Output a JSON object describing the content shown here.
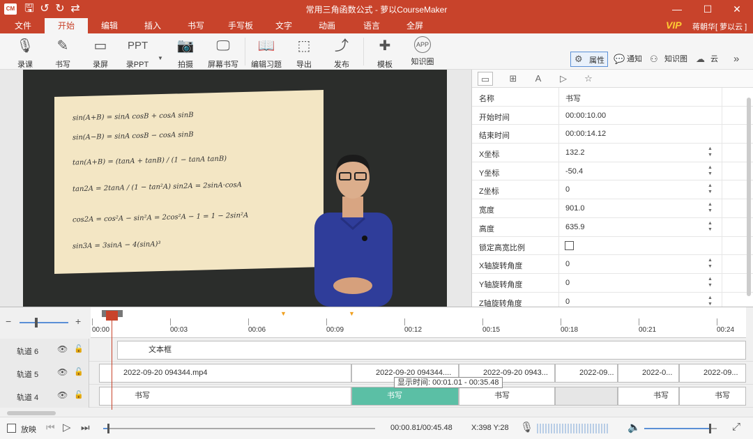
{
  "window": {
    "title": "常用三角函数公式 - 萝以CourseMaker",
    "logo_text": "CM",
    "min_icon": "—",
    "max_icon": "☐",
    "close_icon": "✕"
  },
  "menu": {
    "items": [
      "文件",
      "开始",
      "编辑",
      "插入",
      "书写",
      "手写板",
      "文字",
      "动画",
      "语言",
      "全屏"
    ],
    "active_index": 1,
    "vip": "VIP",
    "user": "蒋朝华[ 萝以云 ]"
  },
  "ribbon": {
    "buttons": [
      {
        "label": "录课",
        "icon": "🎙"
      },
      {
        "label": "书写",
        "icon": "✎"
      },
      {
        "label": "录屏",
        "icon": "▭"
      },
      {
        "label": "录PPT",
        "icon": "PPT"
      },
      {
        "label": "拍摄",
        "icon": "📷"
      },
      {
        "label": "屏幕书写",
        "icon": "🖵"
      },
      {
        "label": "编辑习题",
        "icon": "📖"
      },
      {
        "label": "导出",
        "icon": "⬚"
      },
      {
        "label": "发布",
        "icon": "⤴"
      },
      {
        "label": "模板",
        "icon": "✚"
      },
      {
        "label": "知识圈",
        "icon": "APP"
      }
    ],
    "right_tabs": {
      "properties": "属性",
      "notice": "通知",
      "knowledge": "知识图",
      "cloud": "云",
      "more": "»"
    }
  },
  "board": {
    "equations": [
      "sin(A+B) = sinA cosB + cosA sinB",
      "sin(A−B) = sinA cosB − cosA sinB",
      "tan(A+B) = (tanA + tanB) / (1 − tanA tanB)",
      "tan2A = 2tanA / (1 − tan²A)      sin2A = 2sinA·cosA",
      "cos2A = cos²A − sin²A = 2cos²A − 1 = 1 − 2sin²A",
      "sin3A = 3sinA − 4(sinA)³"
    ]
  },
  "properties": {
    "rows": [
      {
        "key": "名称",
        "value": "书写",
        "type": "text"
      },
      {
        "key": "开始时间",
        "value": "00:00:10.00",
        "type": "text"
      },
      {
        "key": "结束时间",
        "value": "00:00:14.12",
        "type": "text"
      },
      {
        "key": "X坐标",
        "value": "132.2",
        "type": "spin"
      },
      {
        "key": "Y坐标",
        "value": "-50.4",
        "type": "spin"
      },
      {
        "key": "Z坐标",
        "value": "0",
        "type": "spin"
      },
      {
        "key": "宽度",
        "value": "901.0",
        "type": "spin"
      },
      {
        "key": "高度",
        "value": "635.9",
        "type": "spin"
      },
      {
        "key": "锁定高宽比例",
        "value": "",
        "type": "check"
      },
      {
        "key": "X轴旋转角度",
        "value": "0",
        "type": "spin"
      },
      {
        "key": "Y轴旋转角度",
        "value": "0",
        "type": "spin"
      },
      {
        "key": "Z轴旋转角度",
        "value": "0",
        "type": "spin"
      }
    ]
  },
  "timeline": {
    "zoom_minus": "−",
    "zoom_plus": "+",
    "ticks": [
      "00:00",
      "00:03",
      "00:06",
      "00:09",
      "00:12",
      "00:15",
      "00:18",
      "00:21",
      "00:24"
    ],
    "tracks": [
      {
        "name": "轨道 6",
        "clips": [
          {
            "label": "文本框"
          }
        ]
      },
      {
        "name": "轨道 5",
        "clips": [
          {
            "label": "2022-09-20 094344.mp4"
          },
          {
            "label": "2022-09-20 094344...."
          },
          {
            "label": "2022-09-20 0943..."
          },
          {
            "label": "2022-09..."
          },
          {
            "label": "2022-0..."
          },
          {
            "label": "2022-09..."
          }
        ]
      },
      {
        "name": "轨道 4",
        "clips": [
          {
            "label": "书写"
          },
          {
            "label": "书写"
          },
          {
            "label": "书写"
          },
          {
            "label": ""
          },
          {
            "label": "书写"
          },
          {
            "label": "书写"
          }
        ]
      }
    ],
    "tooltip": "显示时间: 00:01.01 - 00:35.48"
  },
  "bottom": {
    "loop_label": "放映",
    "time": "00:00.81/00:45.48",
    "coords": "X:398 Y:28",
    "playback_progress": 0.018,
    "volume": 0.9
  }
}
